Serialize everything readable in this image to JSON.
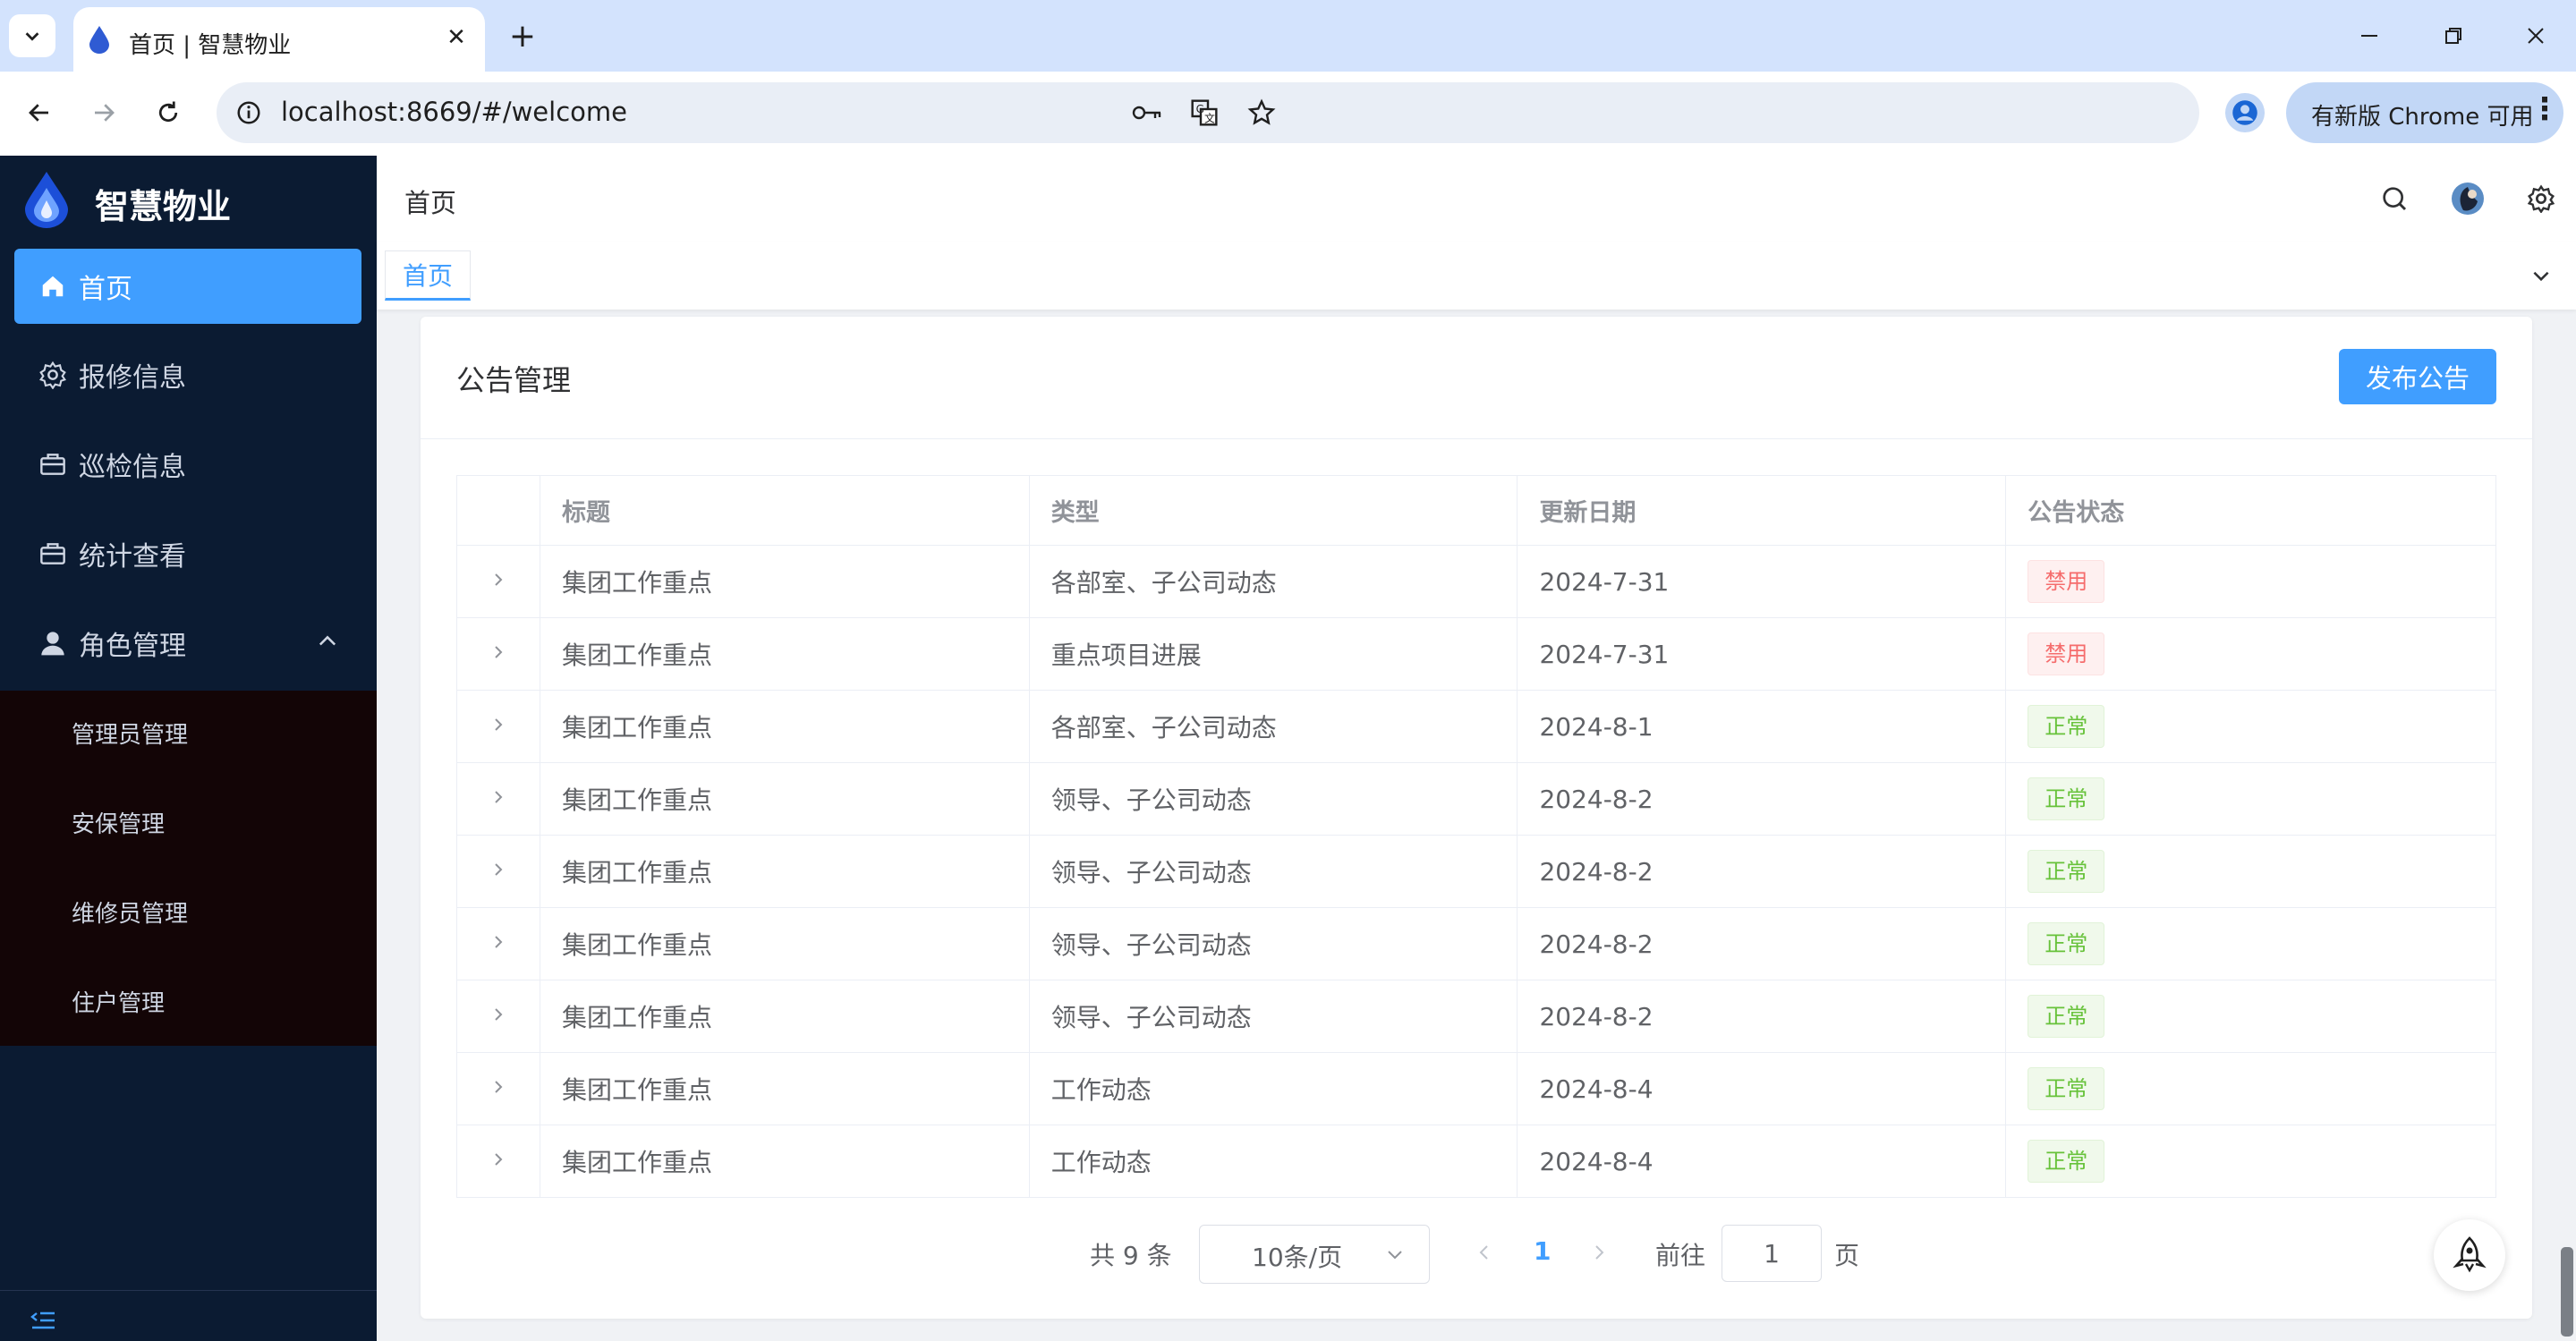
{
  "browser": {
    "tab_title": "首页 | 智慧物业",
    "url": "localhost:8669/#/welcome",
    "update_label": "有新版 Chrome 可用"
  },
  "sidebar": {
    "brand": "智慧物业",
    "items": [
      {
        "label": "首页",
        "icon": "home-icon",
        "active": true
      },
      {
        "label": "报修信息",
        "icon": "gear-icon"
      },
      {
        "label": "巡检信息",
        "icon": "briefcase-icon"
      },
      {
        "label": "统计查看",
        "icon": "briefcase-icon"
      },
      {
        "label": "角色管理",
        "icon": "user-icon",
        "expanded": true
      }
    ],
    "subitems": [
      "管理员管理",
      "安保管理",
      "维修员管理",
      "住户管理"
    ]
  },
  "header": {
    "breadcrumb": "首页",
    "tab": "首页"
  },
  "card": {
    "title": "公告管理",
    "publish_label": "发布公告"
  },
  "table": {
    "columns": [
      "标题",
      "类型",
      "更新日期",
      "公告状态"
    ],
    "rows": [
      {
        "title": "集团工作重点",
        "type": "各部室、子公司动态",
        "date": "2024-7-31",
        "status": "禁用",
        "status_kind": "danger"
      },
      {
        "title": "集团工作重点",
        "type": "重点项目进展",
        "date": "2024-7-31",
        "status": "禁用",
        "status_kind": "danger"
      },
      {
        "title": "集团工作重点",
        "type": "各部室、子公司动态",
        "date": "2024-8-1",
        "status": "正常",
        "status_kind": "success"
      },
      {
        "title": "集团工作重点",
        "type": "领导、子公司动态",
        "date": "2024-8-2",
        "status": "正常",
        "status_kind": "success"
      },
      {
        "title": "集团工作重点",
        "type": "领导、子公司动态",
        "date": "2024-8-2",
        "status": "正常",
        "status_kind": "success"
      },
      {
        "title": "集团工作重点",
        "type": "领导、子公司动态",
        "date": "2024-8-2",
        "status": "正常",
        "status_kind": "success"
      },
      {
        "title": "集团工作重点",
        "type": "领导、子公司动态",
        "date": "2024-8-2",
        "status": "正常",
        "status_kind": "success"
      },
      {
        "title": "集团工作重点",
        "type": "工作动态",
        "date": "2024-8-4",
        "status": "正常",
        "status_kind": "success"
      },
      {
        "title": "集团工作重点",
        "type": "工作动态",
        "date": "2024-8-4",
        "status": "正常",
        "status_kind": "success"
      }
    ]
  },
  "pagination": {
    "total_label": "共 9 条",
    "page_size": "10条/页",
    "current_page": "1",
    "goto_prefix": "前往",
    "goto_value": "1",
    "goto_suffix": "页"
  },
  "colors": {
    "accent": "#409eff",
    "sidebar_bg": "#0b1b32",
    "danger": "#f56c6c",
    "success": "#67c23a"
  }
}
